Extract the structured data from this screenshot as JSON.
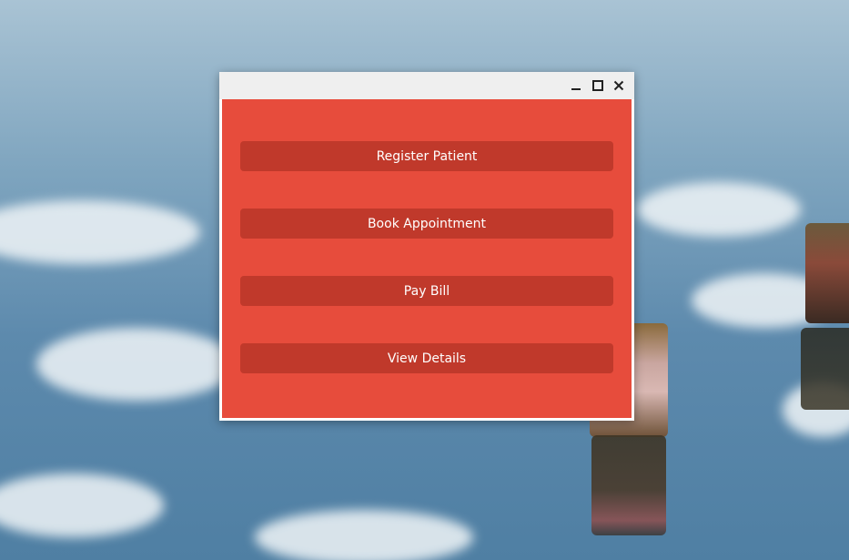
{
  "window": {
    "title": "",
    "controls": {
      "minimize_icon": "minimize-icon",
      "maximize_icon": "maximize-icon",
      "close_icon": "close-icon"
    }
  },
  "actions": [
    {
      "label": "Register Patient"
    },
    {
      "label": "Book Appointment"
    },
    {
      "label": "Pay Bill"
    },
    {
      "label": "View Details"
    }
  ],
  "colors": {
    "panel_background": "#e74c3c",
    "button_background": "#c0392b",
    "button_text": "#ffffff",
    "titlebar": "#efefef"
  }
}
